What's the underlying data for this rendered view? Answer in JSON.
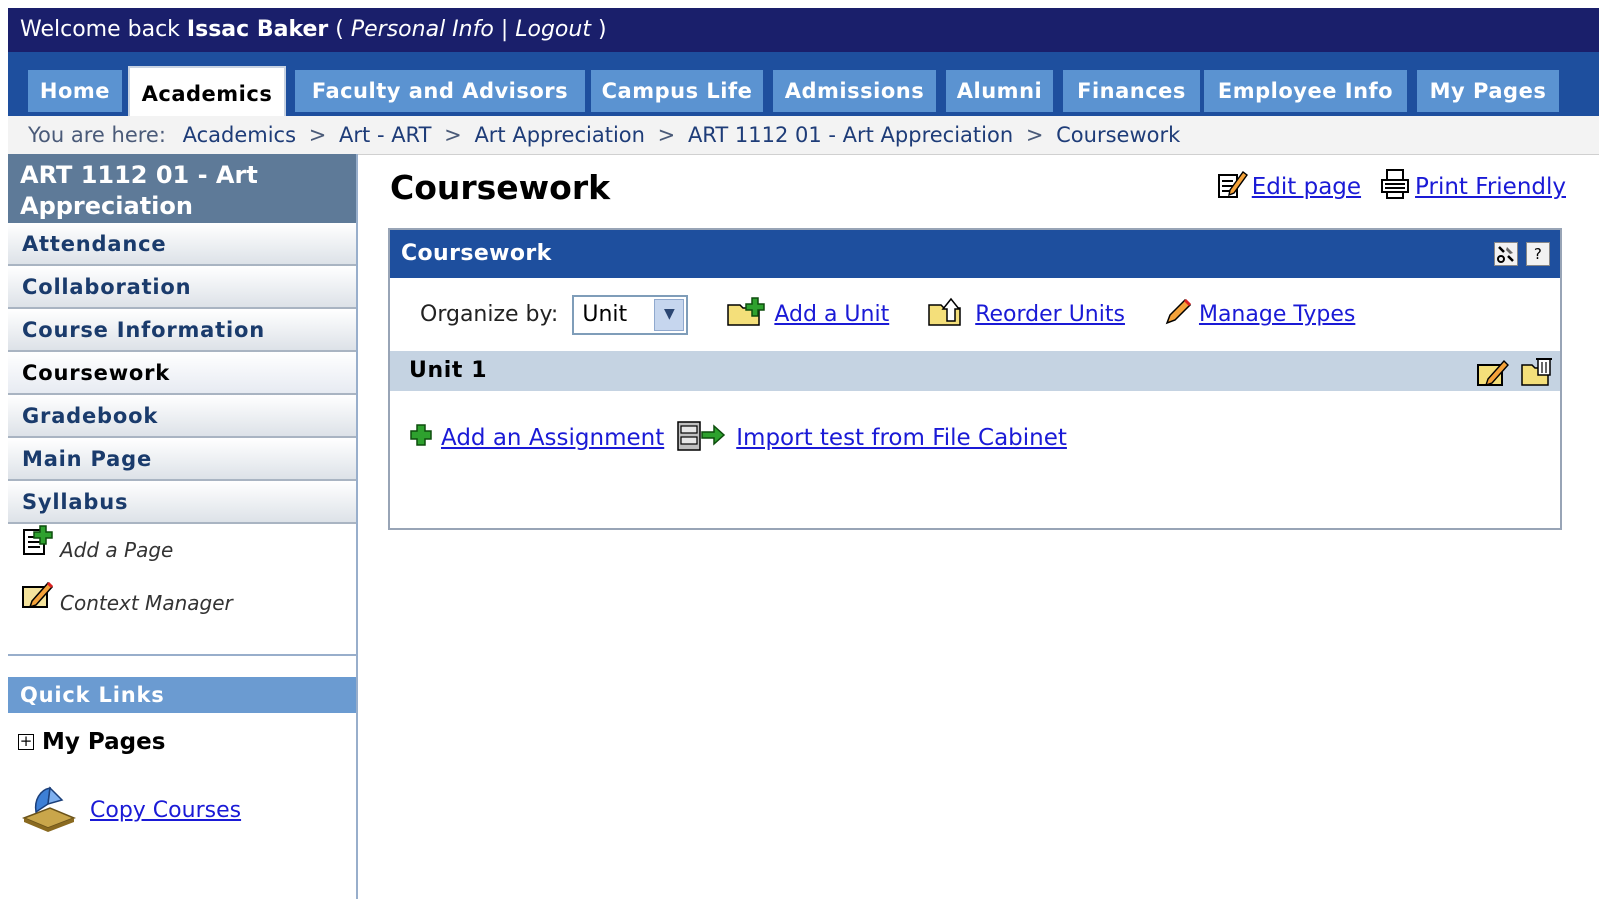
{
  "header": {
    "welcome_prefix": "Welcome back",
    "user_name": "Issac Baker",
    "open_paren": "(",
    "personal_info": "Personal Info",
    "divider": "|",
    "logout": "Logout",
    "close_paren": ")"
  },
  "tabs": [
    {
      "label": "Home"
    },
    {
      "label": "Academics"
    },
    {
      "label": "Faculty and Advisors"
    },
    {
      "label": "Campus Life"
    },
    {
      "label": "Admissions"
    },
    {
      "label": "Alumni"
    },
    {
      "label": "Finances"
    },
    {
      "label": "Employee Info"
    },
    {
      "label": "My Pages"
    }
  ],
  "active_tab": "Academics",
  "breadcrumb": {
    "prefix": "You are here:",
    "sep": ">",
    "items": [
      "Academics",
      "Art - ART",
      "Art Appreciation",
      "ART 1112 01 - Art Appreciation",
      "Coursework"
    ]
  },
  "sidebar": {
    "course_title": "ART 1112 01 - Art Appreciation",
    "items": [
      {
        "label": "Attendance"
      },
      {
        "label": "Collaboration"
      },
      {
        "label": "Course Information"
      },
      {
        "label": "Coursework"
      },
      {
        "label": "Gradebook"
      },
      {
        "label": "Main Page"
      },
      {
        "label": "Syllabus"
      }
    ],
    "active_item": "Coursework",
    "add_page": "Add a Page",
    "context_manager": "Context Manager"
  },
  "quick_links": {
    "title": "Quick Links",
    "my_pages": "My Pages",
    "my_pages_toggle": "+",
    "copy_courses": "Copy Courses"
  },
  "main": {
    "title": "Coursework",
    "edit_page": "Edit page",
    "print_friendly": "Print Friendly",
    "panel": {
      "title": "Coursework",
      "help": "?",
      "organize_label": "Organize by:",
      "organize_value": "Unit",
      "add_unit": "Add a Unit",
      "reorder_units": "Reorder Units",
      "manage_types": "Manage Types",
      "unit_title": "Unit 1",
      "add_assignment": "Add an Assignment",
      "import_test": "Import test from File Cabinet"
    }
  },
  "colors": {
    "welcome_bar": "#1a1f6b",
    "tab_strip": "#1e4f9e",
    "tab": "#5b93d1",
    "panel_header": "#1e4f9e",
    "unit_bar": "#c5d3e2",
    "link": "#1a1ad6"
  }
}
